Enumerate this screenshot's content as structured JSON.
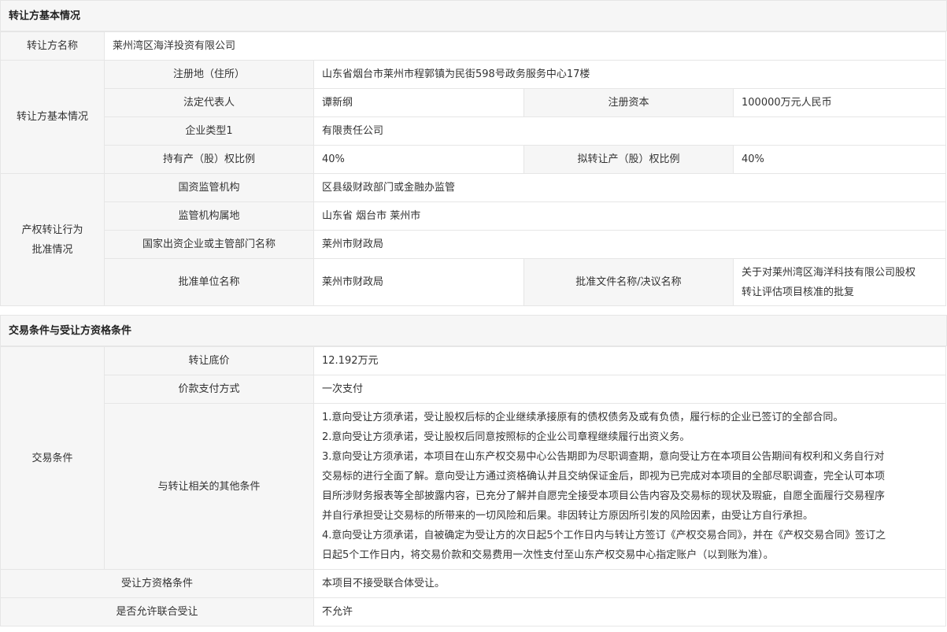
{
  "section1": {
    "title": "转让方基本情况",
    "name_label": "转让方名称",
    "name_value": "莱州湾区海洋投资有限公司",
    "basic_label": "转让方基本情况",
    "reg_addr_label": "注册地（住所）",
    "reg_addr_value": "山东省烟台市莱州市程郭镇为民街598号政务服务中心17楼",
    "legal_rep_label": "法定代表人",
    "legal_rep_value": "谭新纲",
    "reg_capital_label": "注册资本",
    "reg_capital_value": "100000万元人民币",
    "company_type_label": "企业类型1",
    "company_type_value": "有限责任公司",
    "hold_ratio_label": "持有产（股）权比例",
    "hold_ratio_value": "40%",
    "transfer_ratio_label": "拟转让产（股）权比例",
    "transfer_ratio_value": "40%",
    "approval_label_1": "产权转让行为",
    "approval_label_2": "批准情况",
    "regulator_label": "国资监管机构",
    "regulator_value": "区县级财政部门或金融办监管",
    "regulator_loc_label": "监管机构属地",
    "regulator_loc_value": "山东省 烟台市 莱州市",
    "dept_label": "国家出资企业或主管部门名称",
    "dept_value": "莱州市财政局",
    "approver_label": "批准单位名称",
    "approver_value": "莱州市财政局",
    "doc_label": "批准文件名称/决议名称",
    "doc_value_1": "关于对莱州湾区海洋科技有限公司股权",
    "doc_value_2": "转让评估项目核准的批复"
  },
  "section2": {
    "title": "交易条件与受让方资格条件",
    "trade_label": "交易条件",
    "price_label": "转让底价",
    "price_value": "12.192万元",
    "payment_label": "价款支付方式",
    "payment_value": "一次支付",
    "other_label": "与转让相关的其他条件",
    "other_lines": [
      "1.意向受让方须承诺，受让股权后标的企业继续承接原有的债权债务及或有负债，履行标的企业已签订的全部合同。",
      "2.意向受让方须承诺，受让股权后同意按照标的企业公司章程继续履行出资义务。",
      "3.意向受让方须承诺，本项目在山东产权交易中心公告期即为尽职调查期，意向受让方在本项目公告期间有权利和义务自行对",
      "交易标的进行全面了解。意向受让方通过资格确认并且交纳保证金后，即视为已完成对本项目的全部尽职调查，完全认可本项",
      "目所涉财务报表等全部披露内容，已充分了解并自愿完全接受本项目公告内容及交易标的现状及瑕疵，自愿全面履行交易程序",
      "并自行承担受让交易标的所带来的一切风险和后果。非因转让方原因所引发的风险因素，由受让方自行承担。",
      "4.意向受让方须承诺，自被确定为受让方的次日起5个工作日内与转让方签订《产权交易合同》，并在《产权交易合同》签订之",
      "日起5个工作日内，将交易价款和交易费用一次性支付至山东产权交易中心指定账户（以到账为准）。"
    ],
    "qual_label": "受让方资格条件",
    "qual_value": "本项目不接受联合体受让。",
    "joint_label": "是否允许联合受让",
    "joint_value": "不允许"
  }
}
